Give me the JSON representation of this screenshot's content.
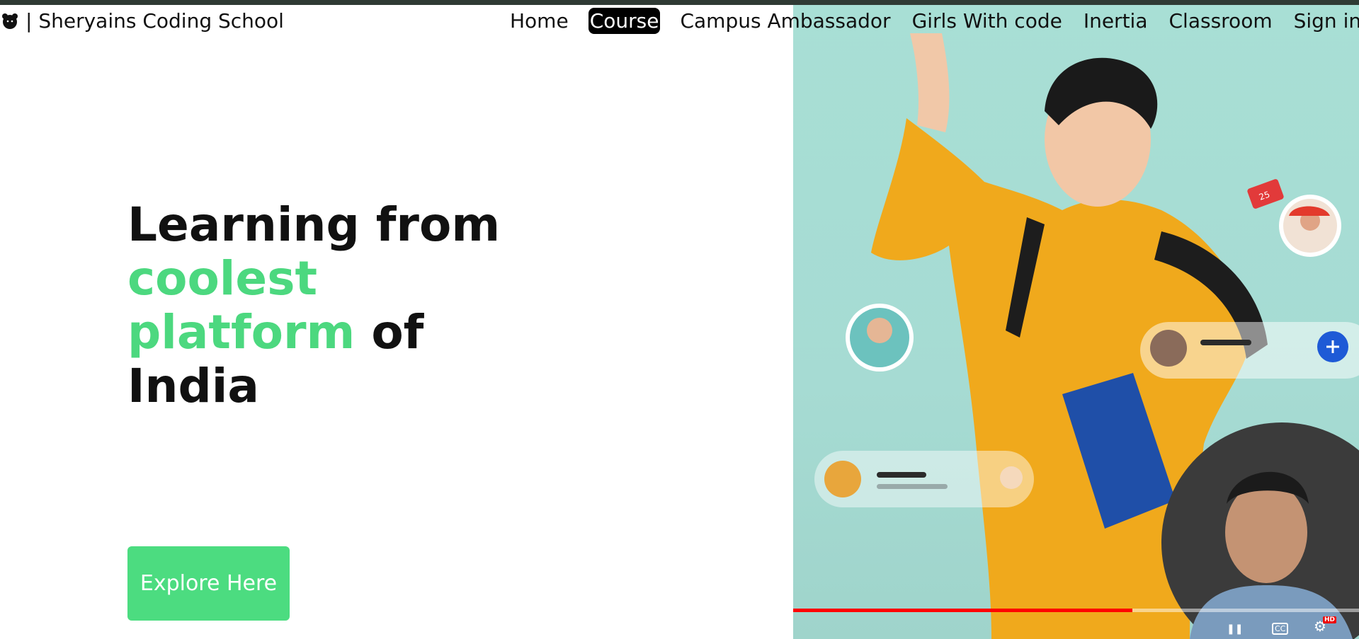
{
  "brand": {
    "name": "| Sheryains Coding School",
    "icon": "bear-icon"
  },
  "nav": {
    "items": [
      "Home",
      "Course",
      "Campus Ambassador",
      "Girls With code",
      "Inertia",
      "Classroom",
      "Sign in"
    ],
    "active": "Course"
  },
  "hero": {
    "line1_plain": "Learning from ",
    "line1_accent": "coolest",
    "line2_accent": "platform",
    "line2_plain": " of",
    "line3_plain": "India",
    "accent_color": "#4cd87f",
    "cta_label": "Explore Here"
  },
  "video": {
    "like_badge": "25",
    "progress_fraction": 0.6,
    "cc_label": "CC",
    "hd_label": "HD"
  }
}
